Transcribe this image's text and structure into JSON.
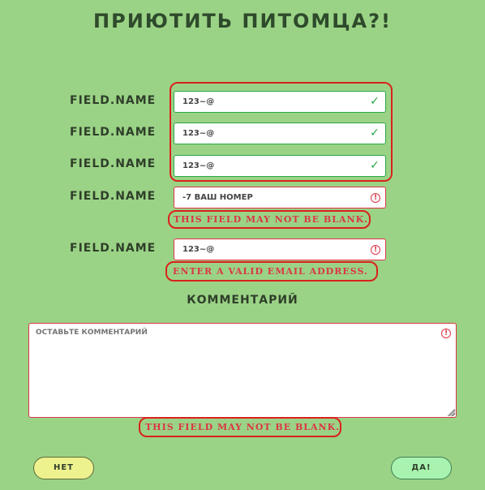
{
  "header": {
    "title": "ПРИЮТИТЬ ПИТОМЦА?!"
  },
  "form": {
    "fields": [
      {
        "label": "FIELD.NAME",
        "value": "123~@",
        "state": "valid",
        "state_icon": "checkmark-icon"
      },
      {
        "label": "FIELD.NAME",
        "value": "123~@",
        "state": "valid",
        "state_icon": "checkmark-icon"
      },
      {
        "label": "FIELD.NAME",
        "value": "123~@",
        "state": "valid",
        "state_icon": "checkmark-icon"
      },
      {
        "label": "FIELD.NAME",
        "value": "-7 ВАШ НОМЕР",
        "state": "invalid",
        "state_icon": "error-icon",
        "error": "THIS FIELD MAY NOT BE BLANK."
      },
      {
        "label": "FIELD.NAME",
        "value": "123~@",
        "state": "invalid",
        "state_icon": "error-icon",
        "error": "ENTER A VALID EMAIL ADDRESS."
      }
    ],
    "comment": {
      "label": "КОММЕНТАРИЙ",
      "placeholder": "ОСТАВЬТЕ КОММЕНТАРИЙ",
      "state": "invalid",
      "error": "THIS FIELD MAY NOT BE BLANK."
    }
  },
  "buttons": {
    "cancel_label": "НЕТ",
    "submit_label": "ДА!"
  },
  "colors": {
    "background": "#9bd386",
    "valid": "#28a745",
    "invalid": "#dc3545",
    "highlight": "#d9221c",
    "cancel_button": "#eef28e",
    "submit_button": "#a8f3b0"
  },
  "error_glyph": "!"
}
